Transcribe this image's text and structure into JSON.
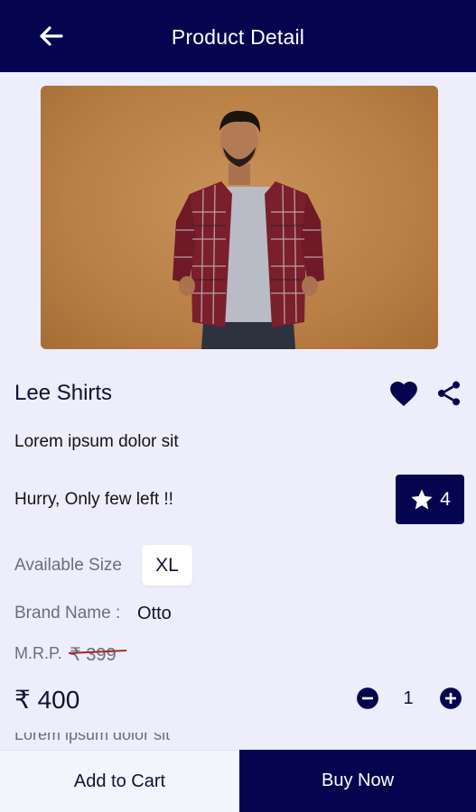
{
  "header": {
    "title": "Product Detail",
    "back_icon": "arrow-left-icon"
  },
  "product": {
    "name": "Lee Shirts",
    "description": "Lorem ipsum dolor sit",
    "stock_message": "Hurry, Only few left !!",
    "rating": "4",
    "available_size_label": "Available Size",
    "selected_size": "XL",
    "brand_label": "Brand Name :",
    "brand_value": "Otto",
    "mrp_label": "M.R.P.",
    "mrp_value": "₹ 399",
    "price": "₹ 400",
    "quantity": "1",
    "cut_off_text": "Lorem ipsum dolor sit"
  },
  "actions": {
    "add_to_cart": "Add to Cart",
    "buy_now": "Buy Now"
  },
  "icons": {
    "heart": "heart-icon",
    "share": "share-icon",
    "star": "star-icon",
    "minus": "minus-circle-icon",
    "plus": "plus-circle-icon"
  },
  "colors": {
    "primary": "#05054f",
    "background": "#ededfb",
    "image_backdrop": "#b97f45"
  }
}
